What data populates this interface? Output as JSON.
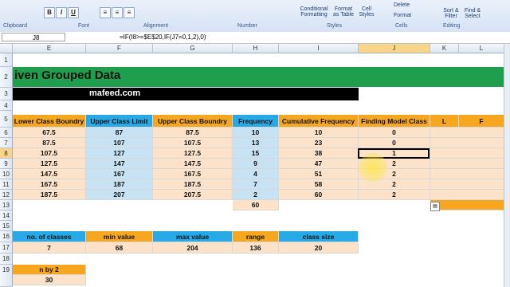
{
  "ribbon": {
    "groups": [
      "Clipboard",
      "Font",
      "Alignment",
      "Number",
      "Styles",
      "Cells",
      "Editing"
    ],
    "buttons": {
      "bold": "B",
      "italic": "I",
      "underline": "U",
      "conditional_formatting": "Conditional Formatting",
      "format_as_table": "Format as Table",
      "cell_styles": "Cell Styles",
      "delete": "Delete",
      "format": "Format",
      "sort_filter": "Sort & Filter",
      "find_select": "Find & Select"
    }
  },
  "formula_bar": {
    "name_box": "J8",
    "formula": "=IF(I8>=$E$20,IF(J7=0,1,2),0)"
  },
  "columns": [
    "E",
    "F",
    "G",
    "H",
    "I",
    "J",
    "K",
    "L"
  ],
  "rows": [
    "1",
    "2",
    "3",
    "4",
    "5",
    "6",
    "7",
    "8",
    "9",
    "10",
    "11",
    "12",
    "13",
    "14",
    "15",
    "16",
    "17",
    "18",
    "19"
  ],
  "sheet": {
    "title": "iven Grouped Data",
    "website": "mafeed.com",
    "headers": {
      "lower": "Lower Class Boundry",
      "upper_limit": "Upper Class Limit",
      "upper_boundry": "Upper Class Boundry",
      "frequency": "Frequency",
      "cumulative": "Cumulative Frequency",
      "model_class": "Finding Model Class",
      "L": "L",
      "F": "F"
    },
    "data_rows": [
      [
        "67.5",
        "87",
        "87.5",
        "10",
        "10",
        "0"
      ],
      [
        "87.5",
        "107",
        "107.5",
        "13",
        "23",
        "0"
      ],
      [
        "107.5",
        "127",
        "127.5",
        "15",
        "38",
        "1"
      ],
      [
        "127.5",
        "147",
        "147.5",
        "9",
        "47",
        "2"
      ],
      [
        "147.5",
        "167",
        "167.5",
        "4",
        "51",
        "2"
      ],
      [
        "167.5",
        "187",
        "187.5",
        "7",
        "58",
        "2"
      ],
      [
        "187.5",
        "207",
        "207.5",
        "2",
        "60",
        "2"
      ]
    ],
    "total_frequency": "60",
    "stats_headers": [
      "no. of classes",
      "min value",
      "max value",
      "range",
      "class size"
    ],
    "stats_values": [
      "7",
      "68",
      "204",
      "136",
      "20"
    ],
    "n_by_2_label": "n by 2",
    "n_by_2_value": "30"
  },
  "colors": {
    "green": "#1f9f4e",
    "peach": "#fbe2c9",
    "blue_col": "#c7e2f3",
    "orange_hdr": "#f7a71f",
    "blue_hdr": "#26a9e6"
  }
}
